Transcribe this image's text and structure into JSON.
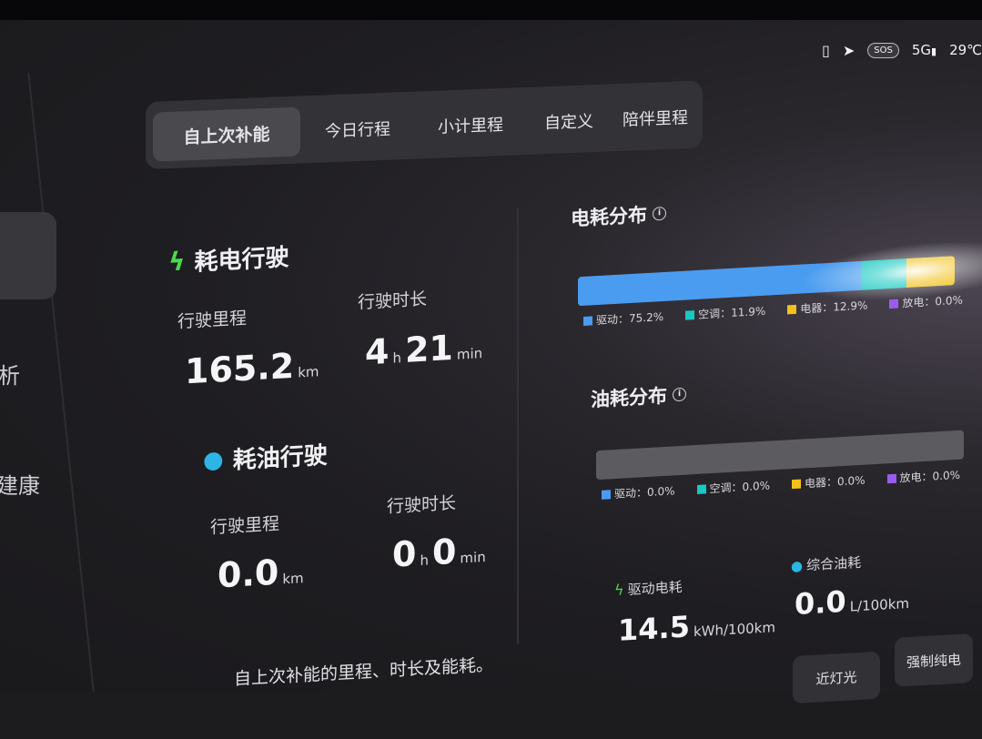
{
  "status": {
    "battery_icon": "battery-icon",
    "nav_icon": "navigation-arrow-icon",
    "sos": "SOS",
    "network": "5G",
    "temperature": "29℃"
  },
  "sidebar": {
    "item1": "析",
    "item2": "建康"
  },
  "tabs": [
    "自上次补能",
    "今日行程",
    "小计里程",
    "自定义",
    "陪伴里程"
  ],
  "electric": {
    "title": "耗电行驶",
    "distance_label": "行驶里程",
    "distance_value": "165.2",
    "distance_unit": "km",
    "duration_label": "行驶时长",
    "hours": "4",
    "hours_unit": "h",
    "minutes": "21",
    "minutes_unit": "min"
  },
  "fuel": {
    "title": "耗油行驶",
    "distance_label": "行驶里程",
    "distance_value": "0.0",
    "distance_unit": "km",
    "duration_label": "行驶时长",
    "hours": "0",
    "hours_unit": "h",
    "minutes": "0",
    "minutes_unit": "min"
  },
  "note": "自上次补能的里程、时长及能耗。",
  "elec_dist": {
    "title": "电耗分布",
    "legend": [
      "驱动：75.2%",
      "空调：11.9%",
      "电器：12.9%",
      "放电：0.0%"
    ],
    "shares": [
      75.2,
      11.9,
      12.9,
      0.0
    ],
    "colors": [
      "#4a9cf0",
      "#17c9c2",
      "#f2c21b",
      "#9a5cf0"
    ]
  },
  "fuel_dist": {
    "title": "油耗分布",
    "legend": [
      "驱动：0.0%",
      "空调：0.0%",
      "电器：0.0%",
      "放电：0.0%"
    ],
    "shares": [
      0.0,
      0.0,
      0.0,
      0.0
    ],
    "colors": [
      "#4a9cf0",
      "#17c9c2",
      "#f2c21b",
      "#9a5cf0"
    ]
  },
  "consumption": {
    "elec_label": "驱动电耗",
    "elec_value": "14.5",
    "elec_unit": "kWh/100km",
    "fuel_label": "综合油耗",
    "fuel_value": "0.0",
    "fuel_unit": "L/100km"
  },
  "buttons": {
    "lights": "近灯光",
    "force_ev": "强制纯电"
  }
}
